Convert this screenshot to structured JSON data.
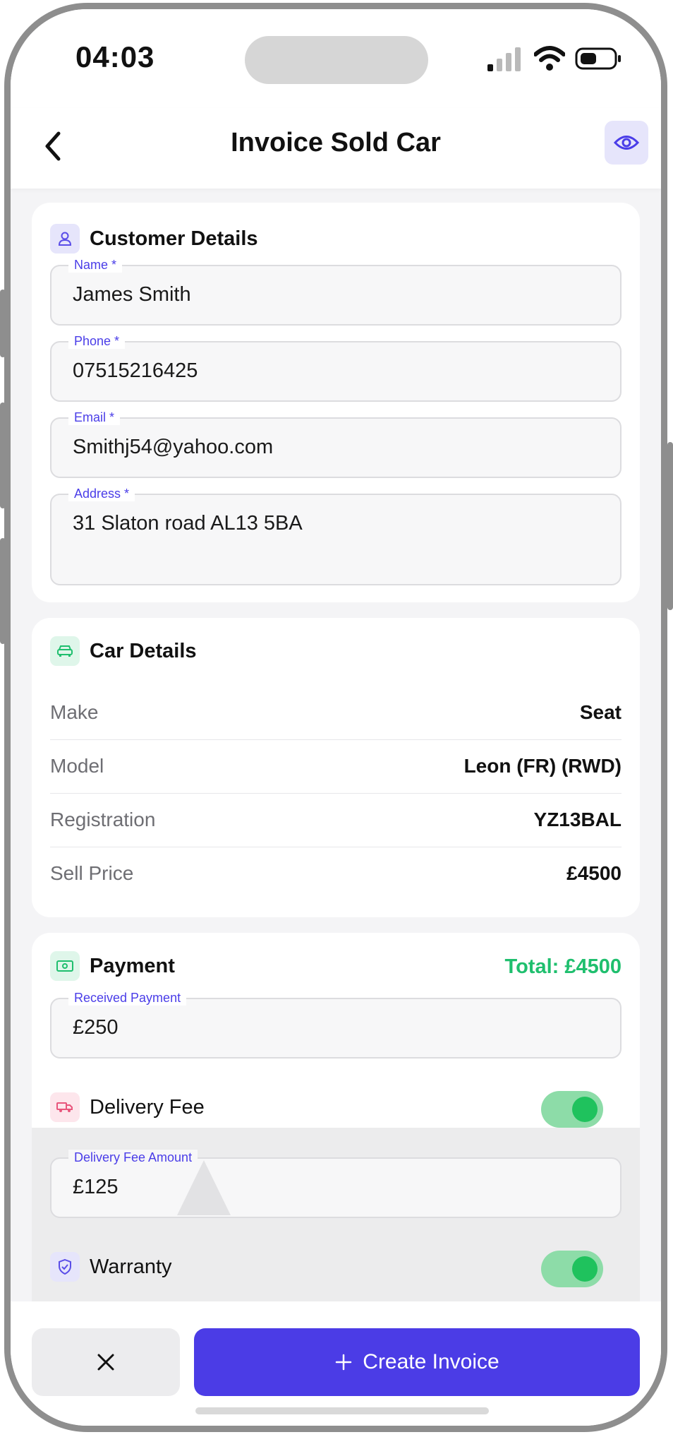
{
  "status_bar": {
    "time": "04:03"
  },
  "header": {
    "title": "Invoice Sold Car"
  },
  "customer": {
    "title": "Customer Details",
    "name_label": "Name *",
    "name_value": "James Smith",
    "phone_label": "Phone *",
    "phone_value": "07515216425",
    "email_label": "Email *",
    "email_value": "Smithj54@yahoo.com",
    "address_label": "Address *",
    "address_value": "31 Slaton road AL13 5BA"
  },
  "car": {
    "title": "Car Details",
    "rows": [
      {
        "key": "Make",
        "value": "Seat"
      },
      {
        "key": "Model",
        "value": "Leon (FR) (RWD)"
      },
      {
        "key": "Registration",
        "value": "YZ13BAL"
      },
      {
        "key": "Sell Price",
        "value": "£4500"
      }
    ]
  },
  "payment": {
    "title": "Payment",
    "total": "Total: £4500",
    "received_label": "Received Payment",
    "received_value": "£250",
    "delivery_label": "Delivery Fee",
    "delivery_enabled": true,
    "delivery_amount_label": "Delivery Fee Amount",
    "delivery_amount_value": "£125",
    "warranty_label": "Warranty",
    "warranty_enabled": true
  },
  "footer": {
    "create_label": "Create Invoice"
  },
  "colors": {
    "accent": "#4b3ce6",
    "success": "#1fc25d",
    "total": "#1fbf6e"
  }
}
